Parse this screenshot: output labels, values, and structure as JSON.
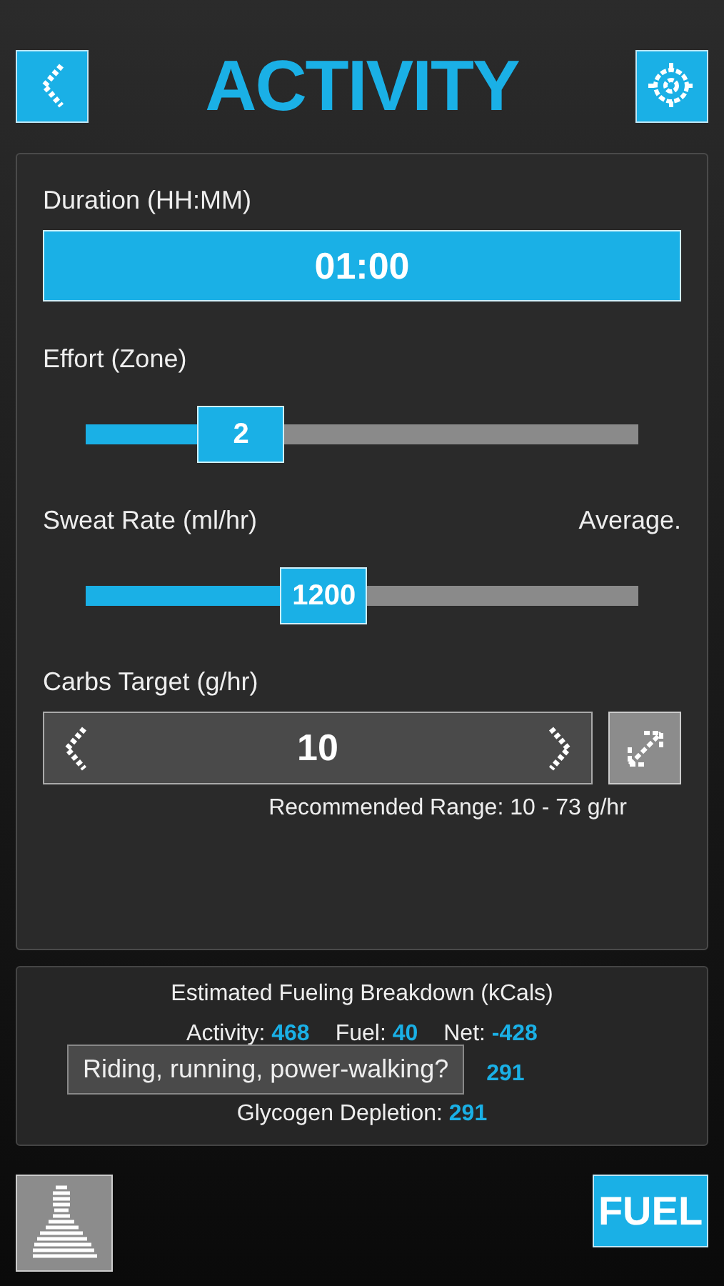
{
  "header": {
    "title": "ACTIVITY"
  },
  "duration": {
    "label": "Duration (HH:MM)",
    "value": "01:00"
  },
  "sliders": [
    {
      "label": "Effort (Zone)",
      "value": "2",
      "level": 0.28
    },
    {
      "label": "Sweat Rate (ml/hr)",
      "hint": "Average.",
      "value": "1200",
      "level": 0.43
    }
  ],
  "carbs": {
    "label": "Carbs Target (g/hr)",
    "value": "10",
    "range": "Recommended Range: 10 - 73 g/hr"
  },
  "breakdown": {
    "title": "Estimated Fueling Breakdown (kCals)",
    "rows": [
      [
        {
          "label": "Activity:",
          "value": "468"
        },
        {
          "label": "Fuel:",
          "value": "40"
        },
        {
          "label": "Net:",
          "value": "-428"
        }
      ],
      [
        "",
        "",
        {
          "value": "291"
        }
      ],
      [
        {
          "label": "Glycogen Depletion:",
          "value": "291"
        }
      ]
    ]
  },
  "tooltip": "Riding, running, power-walking?",
  "fuel_button": "FUEL"
}
